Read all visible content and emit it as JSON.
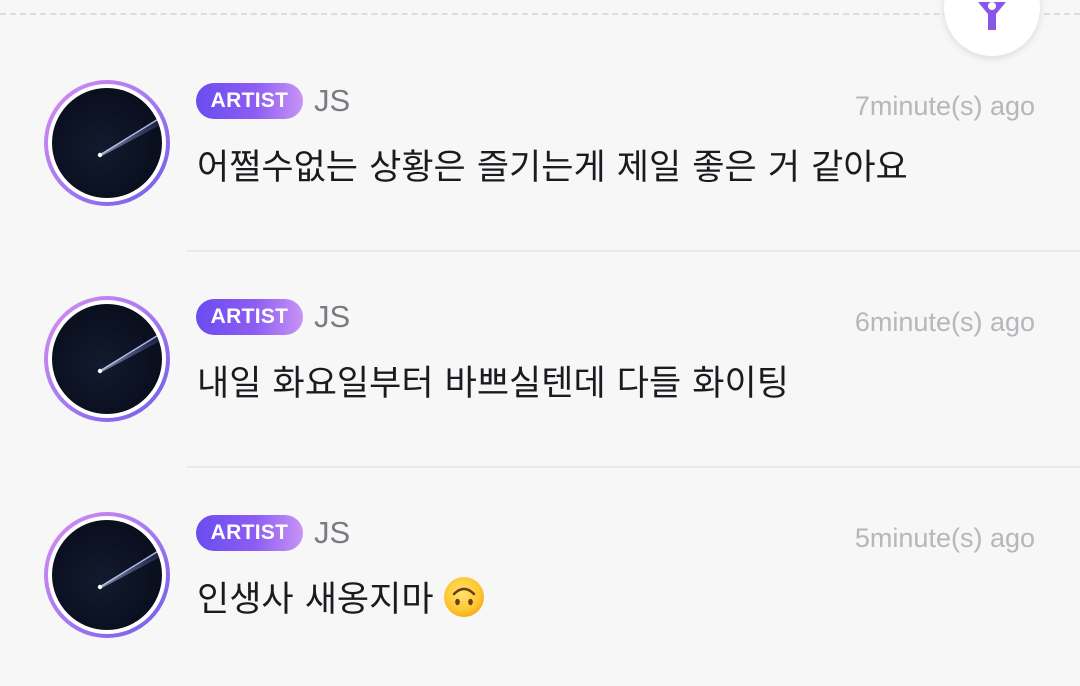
{
  "toolbar": {
    "fab_icon": "lightstick-icon"
  },
  "comments": [
    {
      "badge": "ARTIST",
      "author": "JS",
      "time": "7minute(s) ago",
      "text": "어쩔수없는 상황은 즐기는게 제일 좋은 거 같아요"
    },
    {
      "badge": "ARTIST",
      "author": "JS",
      "time": "6minute(s) ago",
      "text": "내일 화요일부터 바쁘실텐데 다들 화이팅"
    },
    {
      "badge": "ARTIST",
      "author": "JS",
      "time": "5minute(s) ago",
      "text": "인생사 새옹지마",
      "emoji": "upside-down-face-icon"
    }
  ],
  "colors": {
    "badge_start": "#6a4cf0",
    "badge_end": "#c794f5",
    "accent": "#8d5df2"
  }
}
